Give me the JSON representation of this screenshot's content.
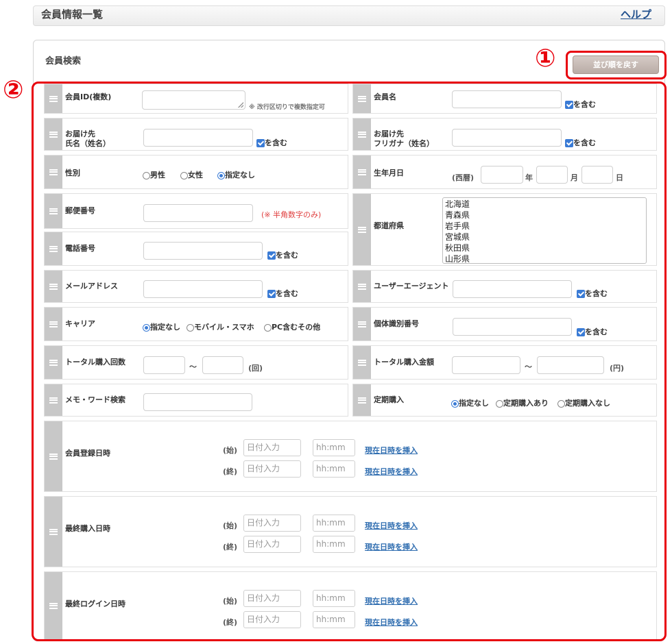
{
  "header": {
    "title": "会員情報一覧",
    "help": "ヘルプ"
  },
  "search": {
    "title": "会員検索",
    "reset_button": "並び順を戻す",
    "marker1": "①",
    "marker2": "②"
  },
  "contains": "を含む",
  "fields": {
    "member_id": {
      "label": "会員ID(複数)",
      "note": "※ 改行区切りで複数指定可"
    },
    "member_name": {
      "label": "会員名"
    },
    "recipient_name": {
      "label": "お届け先\n氏名（姓名）"
    },
    "recipient_kana": {
      "label": "お届け先\nフリガナ（姓名）"
    },
    "gender": {
      "label": "性別",
      "options": [
        "男性",
        "女性",
        "指定なし"
      ],
      "selected": "指定なし"
    },
    "birthday": {
      "label": "生年月日",
      "era": "(西暦)",
      "year": "年",
      "month": "月",
      "day": "日"
    },
    "postal": {
      "label": "郵便番号",
      "note": "(※ 半角数字のみ)"
    },
    "prefecture": {
      "label": "都道府県",
      "options": [
        "北海道",
        "青森県",
        "岩手県",
        "宮城県",
        "秋田県",
        "山形県"
      ]
    },
    "phone": {
      "label": "電話番号"
    },
    "email": {
      "label": "メールアドレス"
    },
    "user_agent": {
      "label": "ユーザーエージェント"
    },
    "carrier": {
      "label": "キャリア",
      "options": [
        "指定なし",
        "モバイル・スマホ",
        "PC含むその他"
      ],
      "selected": "指定なし"
    },
    "device_id": {
      "label": "個体識別番号"
    },
    "total_count": {
      "label": "トータル購入回数",
      "tilde": "～",
      "unit": "(回)"
    },
    "total_amount": {
      "label": "トータル購入金額",
      "tilde": "～",
      "unit": "(円)"
    },
    "memo": {
      "label": "メモ・ワード検索"
    },
    "subscription": {
      "label": "定期購入",
      "options": [
        "指定なし",
        "定期購入あり",
        "定期購入なし"
      ],
      "selected": "指定なし"
    }
  },
  "datetime_common": {
    "start": "(始)",
    "end": "(終)",
    "date_placeholder": "日付入力",
    "time_placeholder": "hh:mm",
    "insert_now": "現在日時を挿入"
  },
  "datetime_rows": [
    {
      "label": "会員登録日時"
    },
    {
      "label": "最終購入日時"
    },
    {
      "label": "最終ログイン日時"
    }
  ]
}
